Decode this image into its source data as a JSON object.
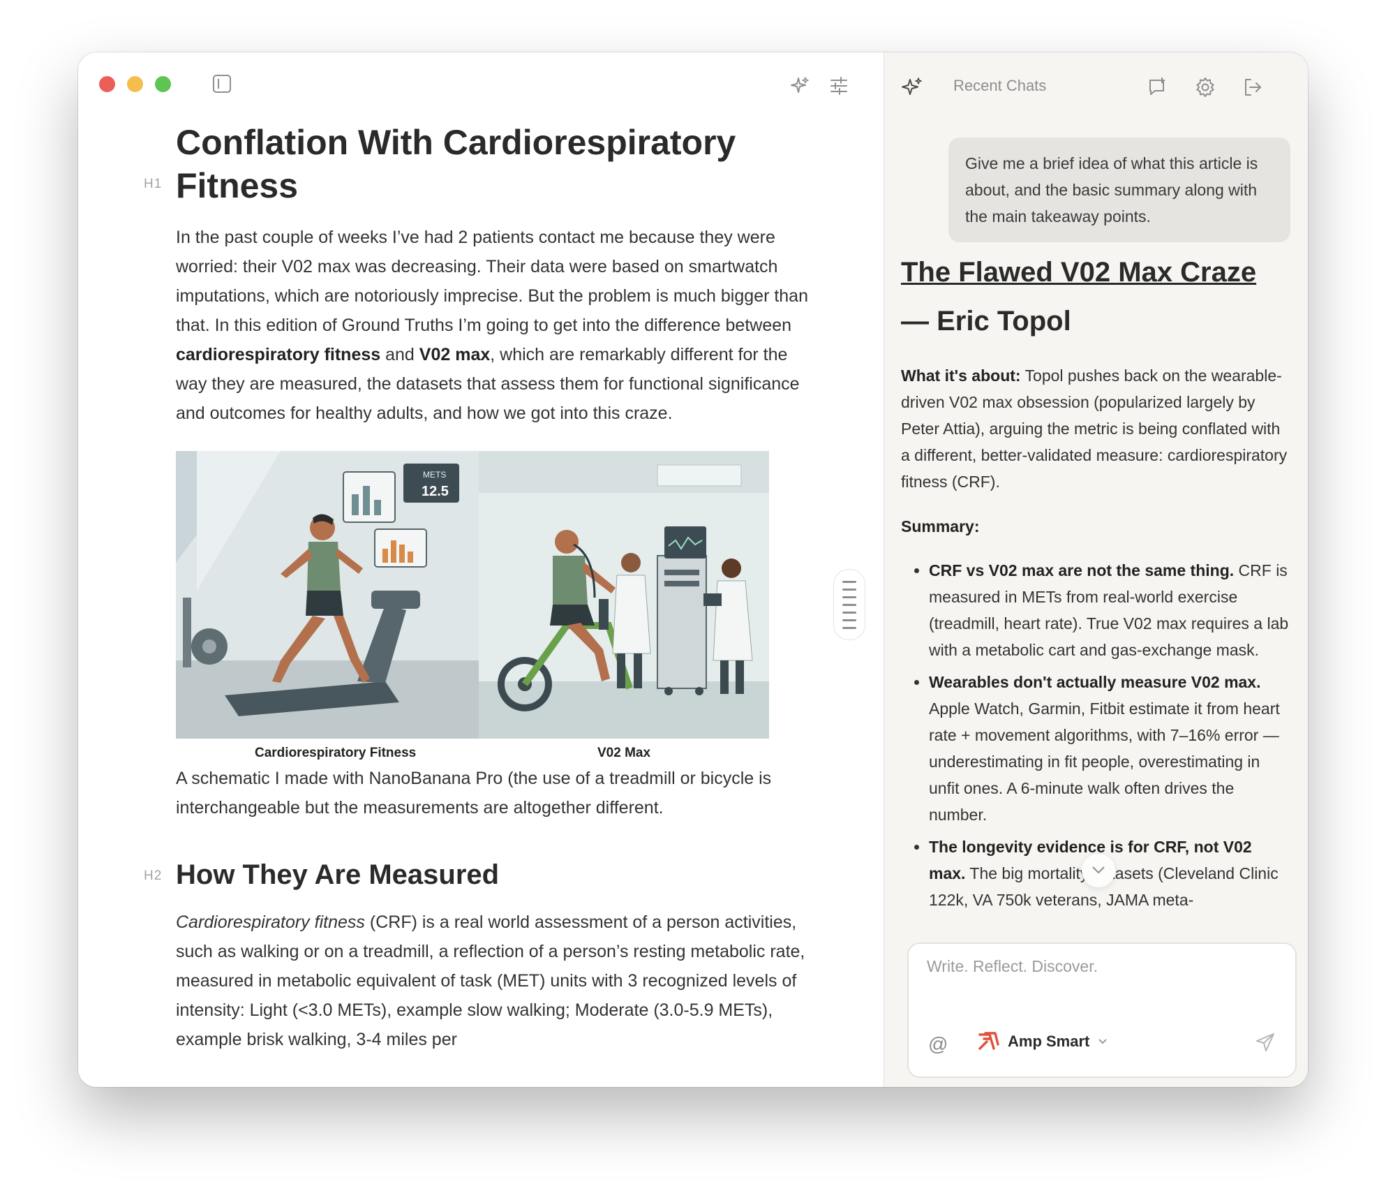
{
  "window": {
    "toolbar": {
      "sparkle_icon": "sparkle-icon",
      "settings_icon": "sliders-icon",
      "sidebar_icon": "sidebar-toggle-icon"
    }
  },
  "article": {
    "h1": {
      "label": "H1",
      "text": "Conflation With Cardiorespiratory Fitness"
    },
    "intro": {
      "p1": "In the past couple of weeks I’ve had 2 patients contact me because they were worried: their V02 max was decreasing. Their data were based on smartwatch imputations, which are notoriously imprecise. But the problem is much bigger than that. In this edition of Ground Truths I’m going to get into the difference between ",
      "b1": "cardiorespiratory fitness",
      "p2": " and ",
      "b2": "V02 max",
      "p3": ", which are remarkably different for the way they are measured, the datasets that assess them for functional significance and outcomes for healthy adults, and how we got into this craze."
    },
    "figure": {
      "left_caption": "Cardiorespiratory Fitness",
      "right_caption": "V02 Max",
      "monitor_label": "METS",
      "monitor_value": "12.5"
    },
    "figure_caption": "A schematic I made with NanoBanana Pro (the use of a treadmill or bicycle is interchangeable but the measurements are altogether different.",
    "h2": {
      "label": "H2",
      "text": "How They Are Measured"
    },
    "measured": {
      "term": "Cardiorespiratory fitness",
      "text": " (CRF) is a real world assessment of a person activities, such as walking or on a treadmill, a reflection of a person’s resting metabolic rate, measured in metabolic equivalent of task (MET) units with 3 recognized levels of intensity: Light (<3.0 METs), example slow walking; Moderate (3.0-5.9 METs), example brisk walking, 3-4 miles per"
    }
  },
  "chat": {
    "header": {
      "title": "Recent Chats"
    },
    "user_message": "Give me a brief idea of what this article is about, and the basic summary along with the main takeaway points.",
    "response": {
      "title_link": "The Flawed V02 Max Craze",
      "title_rest": " — Eric Topol",
      "about_label": "What it's about:",
      "about_text": " Topol pushes back on the wearable-driven V02 max obsession (popularized largely by Peter Attia), arguing the metric is being conflated with a different, better-validated measure: cardiorespiratory fitness (CRF).",
      "summary_label": "Summary:",
      "bullets": [
        {
          "bold": "CRF vs V02 max are not the same thing.",
          "text": " CRF is measured in METs from real-world exercise (treadmill, heart rate). True V02 max requires a lab with a metabolic cart and gas-exchange mask."
        },
        {
          "bold": "Wearables don't actually measure V02 max.",
          "text": " Apple Watch, Garmin, Fitbit estimate it from heart rate + movement algorithms, with 7–16% error — underestimating in fit people, overestimating in unfit ones. A 6-minute walk often drives the number."
        },
        {
          "bold": "The longevity evidence is for CRF, not V02 max.",
          "text": " The big mortality datasets (Cleveland Clinic 122k, VA 750k veterans, JAMA meta-"
        }
      ]
    },
    "composer": {
      "placeholder": "Write. Reflect. Discover.",
      "model": "Amp Smart"
    }
  }
}
